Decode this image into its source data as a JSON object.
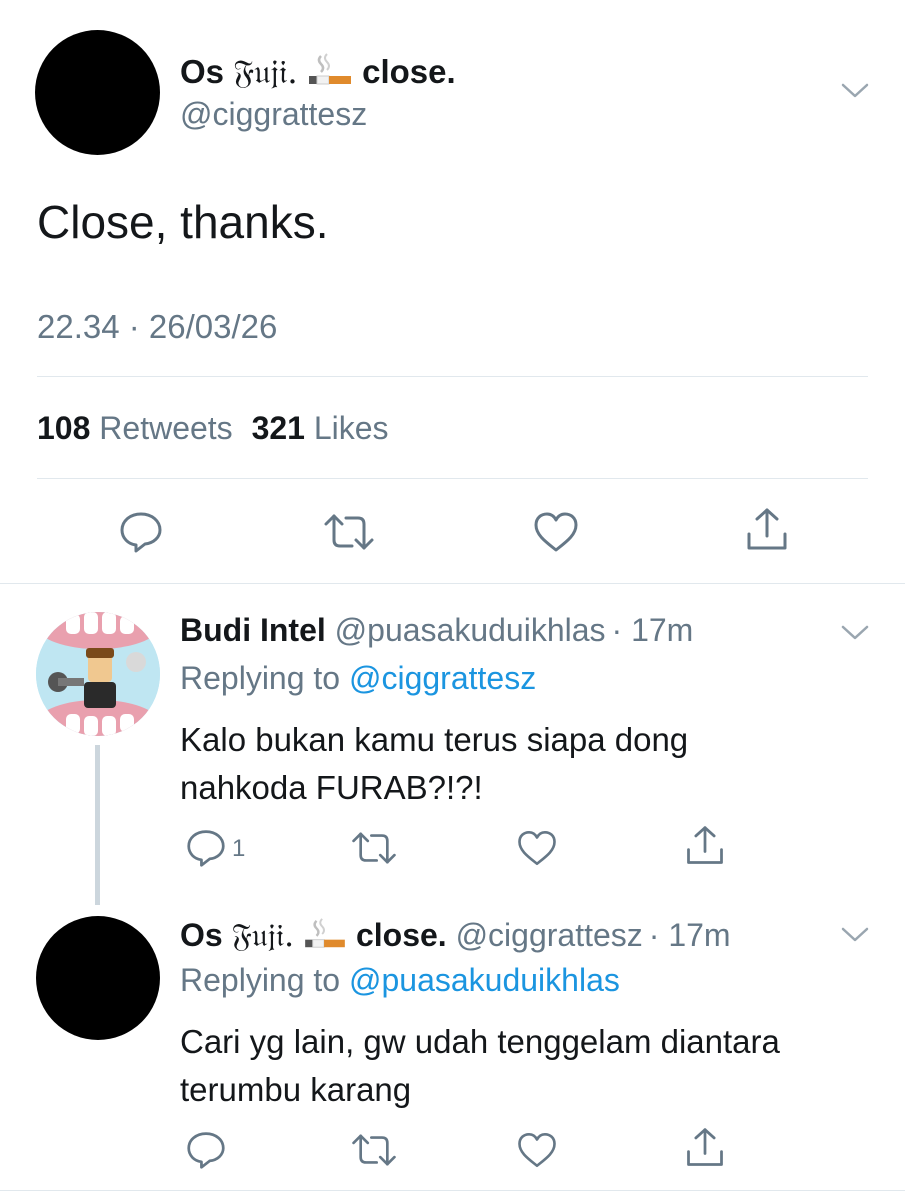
{
  "main_tweet": {
    "display_name_prefix": "Os ",
    "display_name_fraktur": "𝔉𝔲𝔧𝔦.",
    "display_name_suffix": "close.",
    "handle": "@ciggrattesz",
    "text": "Close, thanks.",
    "timestamp": "22.34 · 26/03/26",
    "retweets_count": "108",
    "retweets_label": "Retweets",
    "likes_count": "321",
    "likes_label": "Likes"
  },
  "replies": [
    {
      "display_name": "Budi Intel",
      "handle": "@puasakuduikhlas",
      "time": "· 17m",
      "replying_prefix": "Replying to",
      "replying_to": "@ciggrattesz",
      "text_line1": "Kalo bukan kamu terus siapa dong",
      "text_line2": "nahkoda FURAB?!?!",
      "reply_count": "1"
    },
    {
      "display_name_prefix": "Os ",
      "display_name_fraktur": "𝔉𝔲𝔧𝔦.",
      "display_name_suffix": "close.",
      "handle": "@ciggrattesz",
      "time": "· 17m",
      "replying_prefix": "Replying to",
      "replying_to": "@puasakuduikhlas",
      "text_line1": "Cari yg lain, gw udah tenggelam diantara",
      "text_line2": "terumbu karang"
    }
  ],
  "icons": [
    "reply-icon",
    "retweet-icon",
    "like-icon",
    "share-icon",
    "chevron-down-icon",
    "cigarette-icon"
  ],
  "colors": {
    "text": "#14171a",
    "secondary": "#657786",
    "link": "#1b95e0",
    "divider": "#e1e8ed"
  }
}
